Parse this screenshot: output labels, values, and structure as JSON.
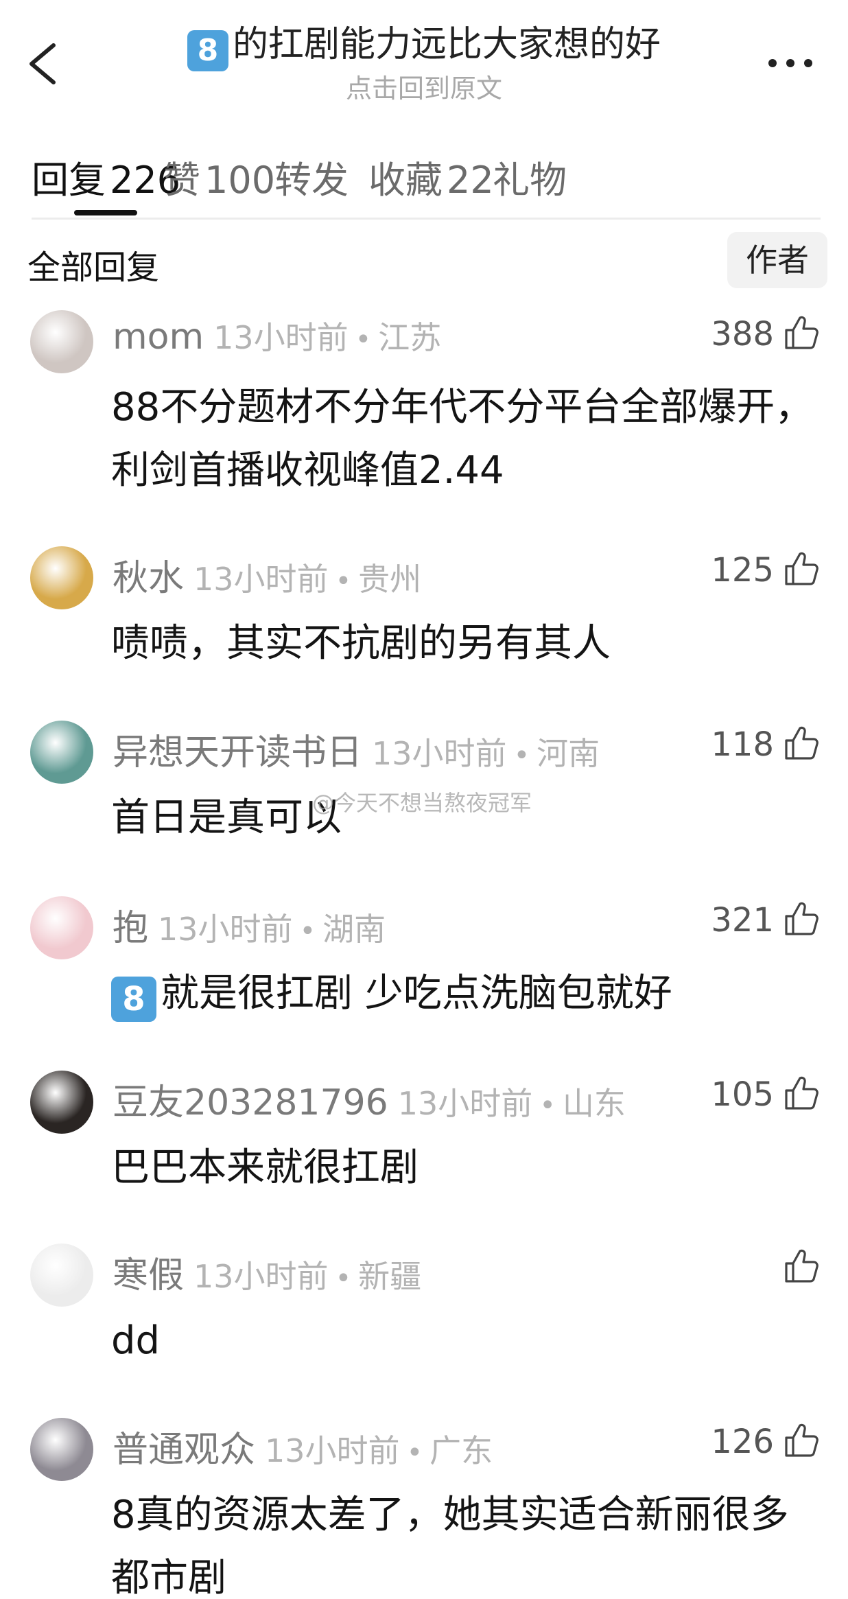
{
  "header": {
    "title_emoji": "8",
    "title": "的扛剧能力远比大家想的好",
    "subtitle": "点击回到原文"
  },
  "tabs": [
    {
      "label": "回复",
      "count": "226"
    },
    {
      "label": "赞",
      "count": "100"
    },
    {
      "label": "转发",
      "count": ""
    },
    {
      "label": "收藏",
      "count": "22"
    },
    {
      "label": "礼物",
      "count": ""
    }
  ],
  "section": {
    "title": "全部回复",
    "author_button": "作者"
  },
  "comments": [
    {
      "name": "mom",
      "time": "13小时前",
      "location": "江苏",
      "likes": "388",
      "text": "88不分题材不分年代不分平台全部爆开，利剑首播收视峰值2.44",
      "text_emoji": "",
      "avatar_color": "#cfc6c2"
    },
    {
      "name": "秋水",
      "time": "13小时前",
      "location": "贵州",
      "likes": "125",
      "text": "啧啧，其实不抗剧的另有其人",
      "text_emoji": "",
      "avatar_color": "#d7a94a"
    },
    {
      "name": "异想天开读书日",
      "time": "13小时前",
      "location": "河南",
      "likes": "118",
      "text": "首日是真可以",
      "text_emoji": "",
      "avatar_color": "#5f9a93"
    },
    {
      "name": "抱",
      "time": "13小时前",
      "location": "湖南",
      "likes": "321",
      "text": "就是很扛剧 少吃点洗脑包就好",
      "text_emoji": "8",
      "avatar_color": "#f1c9cf"
    },
    {
      "name": "豆友203281796",
      "time": "13小时前",
      "location": "山东",
      "likes": "105",
      "text": "巴巴本来就很扛剧",
      "text_emoji": "",
      "avatar_color": "#2a2523"
    },
    {
      "name": "寒假",
      "time": "13小时前",
      "location": "新疆",
      "likes": "",
      "text": "dd",
      "text_emoji": "",
      "avatar_color": "#ececec"
    },
    {
      "name": "普通观众",
      "time": "13小时前",
      "location": "广东",
      "likes": "126",
      "text": "8真的资源太差了，她其实适合新丽很多都市剧",
      "text_emoji": "",
      "avatar_color": "#8e8a93"
    }
  ],
  "watermark": "@今天不想当熬夜冠军"
}
